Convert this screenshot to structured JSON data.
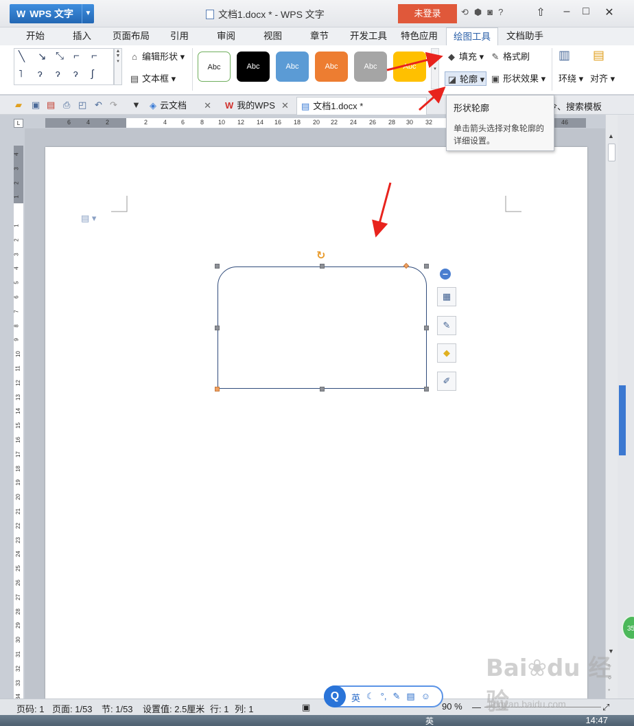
{
  "app": {
    "name": "WPS 文字",
    "window_title": "文档1.docx * - WPS 文字",
    "login": "未登录"
  },
  "menu": {
    "tabs": [
      "开始",
      "插入",
      "页面布局",
      "引用",
      "审阅",
      "视图",
      "章节",
      "开发工具",
      "特色应用",
      "绘图工具",
      "文档助手"
    ],
    "active": "绘图工具"
  },
  "ribbon": {
    "edit_shape": "编辑形状",
    "text_box": "文本框",
    "style_label": "Abc",
    "fill": "填充",
    "format_painter": "格式刷",
    "outline": "轮廓",
    "shape_effect": "形状效果",
    "wrap": "环绕",
    "align": "对齐",
    "style_colors": [
      "#ffffff",
      "#000000",
      "#5b9bd5",
      "#ed7d31",
      "#a5a5a5",
      "#ffc000"
    ]
  },
  "tabs": {
    "cloud": "云文档",
    "mywps": "我的WPS",
    "doc": "文档1.docx *",
    "search": "查找命令、搜索模板"
  },
  "tooltip": {
    "title": "形状轮廓",
    "body": "单击箭头选择对象轮廓的详细设置。"
  },
  "ruler": {
    "h_ticks": [
      "6",
      "4",
      "2",
      "",
      "2",
      "4",
      "6",
      "8",
      "10",
      "12",
      "14",
      "16",
      "18",
      "20",
      "22",
      "24",
      "26",
      "28",
      "30",
      "32",
      "46"
    ],
    "v_ticks": [
      "4",
      "3",
      "2",
      "1",
      "",
      "1",
      "2",
      "3",
      "4",
      "5",
      "6",
      "7",
      "8",
      "9",
      "10",
      "11",
      "12",
      "13",
      "14",
      "15",
      "16",
      "17",
      "18",
      "19",
      "20",
      "21",
      "22",
      "23",
      "24",
      "25",
      "26",
      "27",
      "28",
      "29",
      "30",
      "31",
      "32",
      "33",
      "34"
    ]
  },
  "status": {
    "page": "页码: 1",
    "pages": "页面: 1/53",
    "section": "节: 1/53",
    "setting": "设置值: 2.5厘米",
    "row": "行: 1",
    "col": "列: 1",
    "zoom": "90 %"
  },
  "ime": {
    "logo": "Q",
    "lang": "英"
  },
  "taskbar": {
    "clock": "14:47",
    "ime": "英"
  },
  "watermark": {
    "main": "Bai du 经验",
    "sub": "jingyan.baidu.com"
  },
  "badge": "35"
}
